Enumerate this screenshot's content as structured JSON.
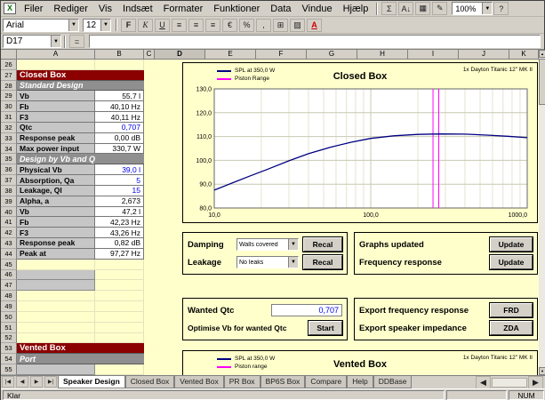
{
  "colors": {
    "sheet_bg": "#FFFFCC",
    "section_red": "#8B0000",
    "subsection_gray": "#8F8F8F",
    "input_blue": "#0000EE",
    "spl_curve": "#000080",
    "piston_magenta": "#FF00FF"
  },
  "icons": {
    "chevron": "▼",
    "up_arrow": "▲",
    "down_arrow": "▼",
    "toolbar1": [
      {
        "name": "autosum-icon",
        "glyph": "Σ"
      },
      {
        "name": "sort-ascending-icon",
        "glyph": "A↓"
      },
      {
        "name": "chart-wizard-icon",
        "glyph": "▦"
      },
      {
        "name": "drawing-icon",
        "glyph": "✎"
      }
    ],
    "toolbar2": [
      {
        "name": "bold-icon",
        "glyph": "F"
      },
      {
        "name": "italic-icon",
        "glyph": "K"
      },
      {
        "name": "underline-icon",
        "glyph": "U"
      },
      {
        "name": "align-left-icon",
        "glyph": "≡"
      },
      {
        "name": "align-center-icon",
        "glyph": "≡"
      },
      {
        "name": "align-right-icon",
        "glyph": "≡"
      },
      {
        "name": "currency-style-icon",
        "glyph": "€"
      },
      {
        "name": "percent-style-icon",
        "glyph": "%"
      },
      {
        "name": "comma-style-icon",
        "glyph": ","
      },
      {
        "name": "borders-icon",
        "glyph": "⊞"
      },
      {
        "name": "fill-color-icon",
        "glyph": "▨"
      },
      {
        "name": "font-color-icon",
        "glyph": "A"
      }
    ],
    "tab_nav": [
      {
        "name": "first-sheet-icon",
        "glyph": "|◀"
      },
      {
        "name": "prev-sheet-icon",
        "glyph": "◀"
      },
      {
        "name": "next-sheet-icon",
        "glyph": "▶"
      },
      {
        "name": "last-sheet-icon",
        "glyph": "▶|"
      }
    ]
  },
  "menubar": {
    "menus": [
      "Filer",
      "Rediger",
      "Vis",
      "Indsæt",
      "Formater",
      "Funktioner",
      "Data",
      "Vindue",
      "Hjælp"
    ],
    "zoom": "100%",
    "help_glyph": "?"
  },
  "formatting": {
    "font": "Arial",
    "size": "12"
  },
  "formula_bar": {
    "name_box": "D17",
    "equals_glyph": "=",
    "formula": ""
  },
  "columns": [
    "A",
    "B",
    "C",
    "D",
    "E",
    "F",
    "G",
    "H",
    "I",
    "J",
    "K"
  ],
  "active_column": "D",
  "rows": [
    {
      "n": 26,
      "type": "empty"
    },
    {
      "n": 27,
      "type": "section",
      "label": "Closed Box"
    },
    {
      "n": 28,
      "type": "subsection",
      "label": "Standard Design"
    },
    {
      "n": 29,
      "type": "data",
      "label": "Vb",
      "value": "55,7 l"
    },
    {
      "n": 30,
      "type": "data",
      "label": "Fb",
      "value": "40,10 Hz"
    },
    {
      "n": 31,
      "type": "data",
      "label": "F3",
      "value": "40,11 Hz"
    },
    {
      "n": 32,
      "type": "data",
      "label": "Qtc",
      "value": "0,707",
      "input": true
    },
    {
      "n": 33,
      "type": "data",
      "label": "Response peak",
      "value": "0,00 dB"
    },
    {
      "n": 34,
      "type": "data",
      "label": "Max power input",
      "value": "330,7 W"
    },
    {
      "n": 35,
      "type": "subsection",
      "label": "Design by Vb and Q"
    },
    {
      "n": 36,
      "type": "data",
      "label": "Physical Vb",
      "value": "39,0 l",
      "input": true
    },
    {
      "n": 37,
      "type": "data",
      "label": "Absorption, Qa",
      "value": "5",
      "input": true
    },
    {
      "n": 38,
      "type": "data",
      "label": "Leakage, Ql",
      "value": "15",
      "input": true
    },
    {
      "n": 39,
      "type": "data",
      "label": "Alpha, a",
      "value": "2,673"
    },
    {
      "n": 40,
      "type": "data",
      "label": "Vb",
      "value": "47,2 l"
    },
    {
      "n": 41,
      "type": "data",
      "label": "Fb",
      "value": "42,23 Hz"
    },
    {
      "n": 42,
      "type": "data",
      "label": "F3",
      "value": "43,26 Hz"
    },
    {
      "n": 43,
      "type": "data",
      "label": "Response peak",
      "value": "0,82 dB"
    },
    {
      "n": 44,
      "type": "data",
      "label": "Peak at",
      "value": "97,27 Hz"
    },
    {
      "n": 45,
      "type": "empty"
    },
    {
      "n": 46,
      "type": "graycell"
    },
    {
      "n": 47,
      "type": "graycell"
    },
    {
      "n": 48,
      "type": "empty"
    },
    {
      "n": 49,
      "type": "empty"
    },
    {
      "n": 50,
      "type": "empty"
    },
    {
      "n": 51,
      "type": "empty"
    },
    {
      "n": 52,
      "type": "empty"
    },
    {
      "n": 53,
      "type": "section",
      "label": "Vented Box"
    },
    {
      "n": 54,
      "type": "subsection",
      "label": "Port"
    },
    {
      "n": 55,
      "type": "graycell"
    }
  ],
  "controls": {
    "damping": {
      "label": "Damping",
      "value": "Walls covered",
      "button": "Recal"
    },
    "leakage": {
      "label": "Leakage",
      "value": "No leaks",
      "button": "Recal"
    },
    "graphs_updated": {
      "label": "Graphs updated",
      "button": "Update"
    },
    "frequency_response": {
      "label": "Frequency response",
      "button": "Update"
    },
    "wanted_qtc": {
      "label": "Wanted Qtc",
      "value": "0,707"
    },
    "optimise": {
      "label": "Optimise Vb for wanted Qtc",
      "button": "Start"
    },
    "export_frd": {
      "label": "Export frequency response",
      "button": "FRD"
    },
    "export_zda": {
      "label": "Export speaker impedance",
      "button": "ZDA"
    }
  },
  "chart_data": [
    {
      "type": "line",
      "title": "Closed Box",
      "annotation": "1x Dayton Titanic 12\" MK II",
      "legend": [
        "SPL at 350,0 W",
        "Piston Range"
      ],
      "x_scale": "log",
      "xlim": [
        10,
        1000
      ],
      "ylim": [
        80,
        130
      ],
      "yticks": [
        130,
        120,
        110,
        100,
        90,
        80
      ],
      "xticks": [
        10,
        100,
        1000
      ],
      "grid": true,
      "legend_position": "top-left",
      "piston_color": "#FF00FF",
      "piston_range_hz": [
        250,
        272
      ],
      "series": [
        {
          "name": "SPL at 350,0 W",
          "color": "#000080",
          "x": [
            10,
            13,
            17,
            22,
            30,
            40,
            55,
            75,
            100,
            140,
            200,
            280,
            400,
            550,
            750,
            1000
          ],
          "y": [
            87.5,
            90.5,
            93.5,
            96.3,
            99.8,
            102.8,
            105.5,
            107.6,
            109.2,
            110.3,
            110.9,
            111.1,
            111.0,
            110.6,
            110.1,
            109.5
          ]
        }
      ]
    },
    {
      "type": "line",
      "title": "Vented Box",
      "annotation": "1x Dayton Titanic 12\" MK II",
      "legend": [
        "SPL at 350,0 W",
        "Piston range"
      ],
      "series_colors": [
        "#000080",
        "#FF00FF"
      ]
    }
  ],
  "sheet_tabs": {
    "active_index": 0,
    "tabs": [
      "Speaker Design",
      "Closed Box",
      "Vented Box",
      "PR Box",
      "BP6S Box",
      "Compare",
      "Help",
      "DDBase"
    ]
  },
  "status": {
    "left": "Klar",
    "right": "NUM"
  }
}
